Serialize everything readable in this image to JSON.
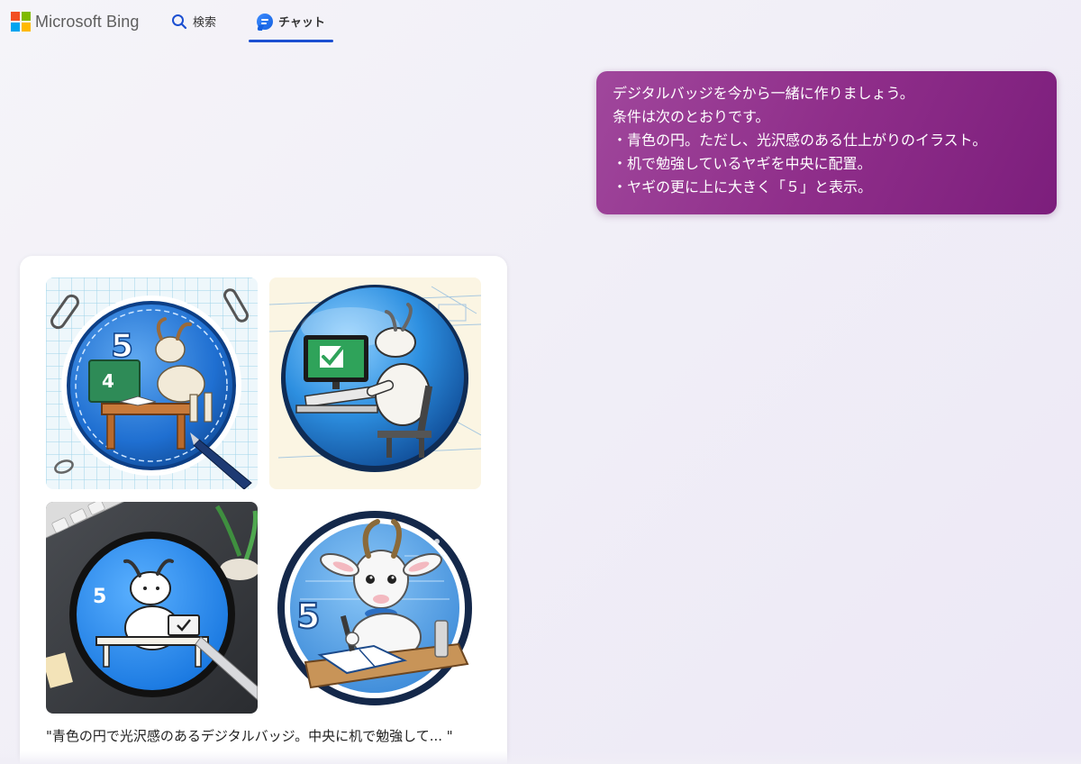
{
  "header": {
    "logo_text": "Microsoft Bing",
    "logo_colors": [
      "#f25022",
      "#7fba00",
      "#00a4ef",
      "#ffb900"
    ],
    "tabs": [
      {
        "label": "検索",
        "icon": "search-icon",
        "active": false
      },
      {
        "label": "チャット",
        "icon": "chat-bubble-icon",
        "active": true
      }
    ],
    "accent_color": "#1b4fd1"
  },
  "user_message": {
    "lines": [
      "デジタルバッジを今から一緒に作りましょう。",
      "条件は次のとおりです。",
      "・青色の円。ただし、光沢感のある仕上がりのイラスト。",
      "・机で勉強しているヤギを中央に配置。",
      "・ヤギの更に上に大きく「５」と表示。"
    ],
    "bubble_color": "#8f2e8a"
  },
  "image_result": {
    "images": [
      {
        "badge_number": "5",
        "board_text": "4"
      },
      {
        "badge_number": "",
        "board_text": ""
      },
      {
        "badge_number": "5",
        "board_text": ""
      },
      {
        "badge_number": "5",
        "board_text": ""
      }
    ],
    "caption": "\"青色の円で光沢感のあるデジタルバッジ。中央に机で勉強して... \""
  }
}
